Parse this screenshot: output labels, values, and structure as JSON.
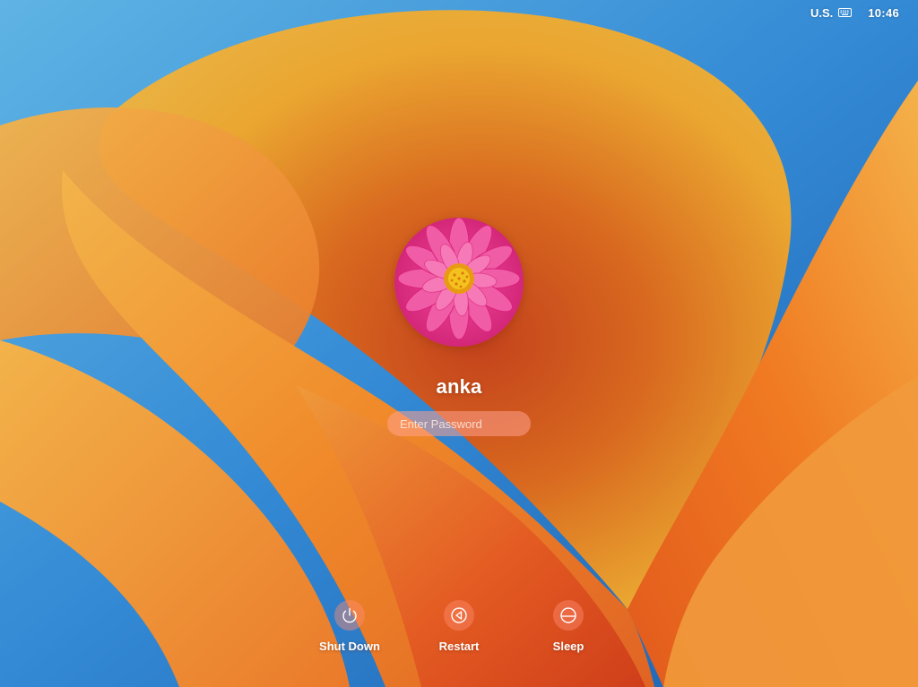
{
  "menubar": {
    "input_source": "U.S.",
    "input_source_icon": "keyboard-icon",
    "clock": "10:46"
  },
  "login": {
    "avatar_icon": "pink-flower-avatar",
    "username": "anka",
    "password": {
      "placeholder": "Enter Password",
      "value": ""
    }
  },
  "power_actions": [
    {
      "label": "Shut Down",
      "icon": "power-icon"
    },
    {
      "label": "Restart",
      "icon": "restart-icon"
    },
    {
      "label": "Sleep",
      "icon": "sleep-icon"
    }
  ],
  "colors": {
    "wallpaper_blue": "#2f7fc8",
    "wallpaper_orange": "#f08a2a",
    "wallpaper_red": "#c8341a",
    "avatar_pink": "#e8318a",
    "avatar_center": "#f2b01e"
  }
}
